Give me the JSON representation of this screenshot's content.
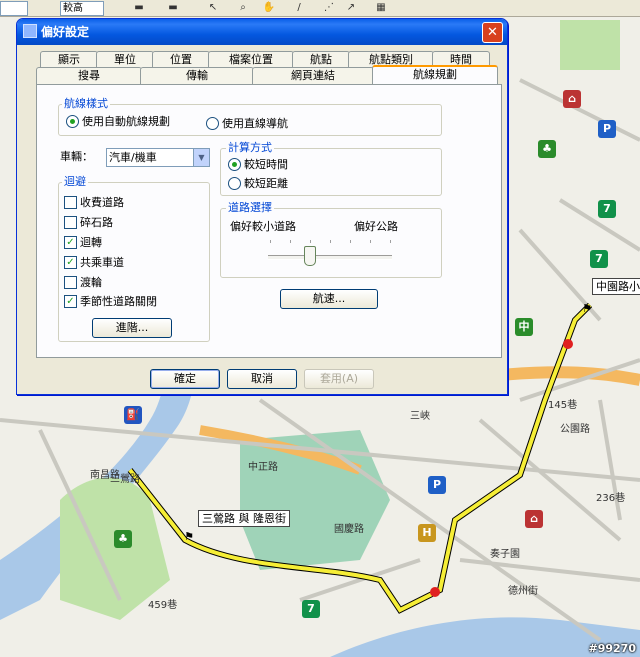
{
  "toolbar": {
    "scale_value": "",
    "zoom_value": "較高"
  },
  "map": {
    "labels": [
      "145巷",
      "236巷",
      "中正路",
      "三鶯路",
      "國慶路",
      "奏子園",
      "德州街",
      "公園路",
      "三峽",
      "459巷",
      "南昌路"
    ],
    "callouts": {
      "start": "三鶯路 與 隆恩街",
      "end": "中園路小"
    },
    "watermark": "#99270"
  },
  "dialog": {
    "title": "偏好設定",
    "tabs_row1": [
      "顯示",
      "單位",
      "位置",
      "檔案位置",
      "航點",
      "航點類別",
      "時間"
    ],
    "tabs_row2": [
      "搜尋",
      "傳輸",
      "網頁連結",
      "航線規劃"
    ],
    "route_style": {
      "label": "航線樣式",
      "options": [
        "使用自動航線規劃",
        "使用直線導航"
      ],
      "selected": 0
    },
    "vehicle": {
      "label": "車輛：",
      "value": "汽車/機車"
    },
    "calc_method": {
      "label": "計算方式",
      "options": [
        "較短時間",
        "較短距離"
      ],
      "selected": 0
    },
    "avoid": {
      "label": "迴避",
      "items": [
        {
          "label": "收費道路",
          "checked": false
        },
        {
          "label": "碎石路",
          "checked": false
        },
        {
          "label": "迴轉",
          "checked": true
        },
        {
          "label": "共乘車道",
          "checked": true
        },
        {
          "label": "渡輪",
          "checked": false
        },
        {
          "label": "季節性道路關閉",
          "checked": true
        }
      ],
      "advanced_button": "進階..."
    },
    "road_selection": {
      "label": "道路選擇",
      "left_label": "偏好較小道路",
      "right_label": "偏好公路",
      "slider_level": 0.33
    },
    "speed_button": "航速...",
    "buttons": {
      "ok": "確定",
      "cancel": "取消",
      "apply": "套用(A)"
    },
    "colors": {
      "accent": "#ff9a00",
      "group_label": "#0046d5",
      "titlebar": "#0458e0"
    }
  }
}
